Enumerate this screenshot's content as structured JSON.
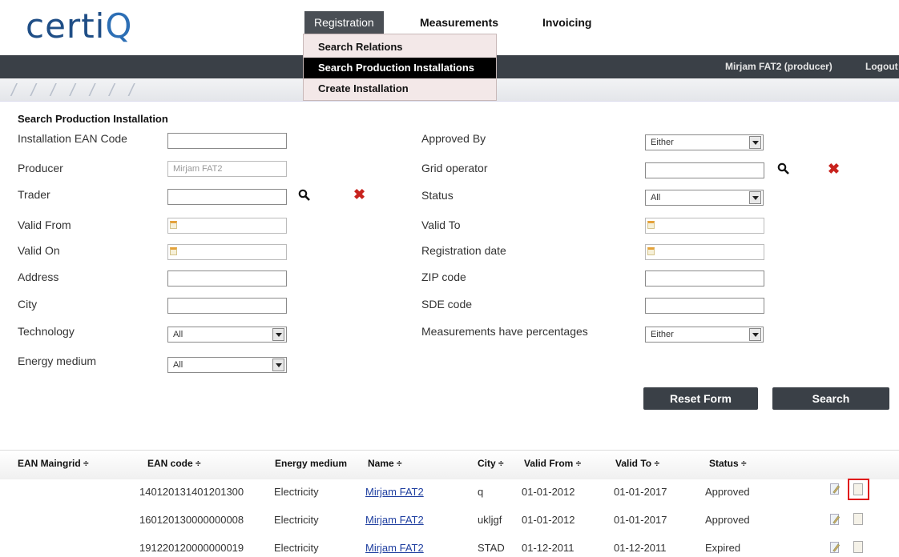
{
  "brand": {
    "logo_prefix": "certi",
    "logo_q": "Q"
  },
  "nav": {
    "items": [
      "Registration",
      "Measurements",
      "Invoicing"
    ],
    "dropdown": [
      "Search Relations",
      "Search Production Installations",
      "Create Installation"
    ]
  },
  "user": {
    "name": "Mirjam FAT2 (producer)",
    "logout": "Logout"
  },
  "form": {
    "title": "Search Production Installation",
    "labels": {
      "ean": "Installation EAN Code",
      "producer": "Producer",
      "trader": "Trader",
      "valid_from": "Valid From",
      "valid_on": "Valid On",
      "address": "Address",
      "city": "City",
      "technology": "Technology",
      "energy_medium": "Energy medium",
      "approved_by": "Approved By",
      "grid_operator": "Grid operator",
      "status": "Status",
      "valid_to": "Valid To",
      "registration_date": "Registration date",
      "zip": "ZIP code",
      "sde": "SDE code",
      "measurements_pct": "Measurements have percentages"
    },
    "values": {
      "producer": "Mirjam FAT2",
      "technology": "All",
      "energy_medium": "All",
      "approved_by": "Either",
      "status": "All",
      "measurements_pct": "Either"
    },
    "buttons": {
      "reset": "Reset Form",
      "search": "Search"
    }
  },
  "table": {
    "headers": [
      "EAN Maingrid ÷",
      "EAN code ÷",
      "Energy medium",
      "Name ÷",
      "City ÷",
      "Valid From ÷",
      "Valid To ÷",
      "Status ÷"
    ],
    "rows": [
      {
        "ean_maingrid": "",
        "ean": "140120131401201300",
        "medium": "Electricity",
        "name": "Mirjam FAT2",
        "city": "q",
        "valid_from": "01-01-2012",
        "valid_to": "01-01-2017",
        "status": "Approved"
      },
      {
        "ean_maingrid": "",
        "ean": "160120130000000008",
        "medium": "Electricity",
        "name": "Mirjam FAT2",
        "city": "ukljgf",
        "valid_from": "01-01-2012",
        "valid_to": "01-01-2017",
        "status": "Approved"
      },
      {
        "ean_maingrid": "",
        "ean": "191220120000000019",
        "medium": "Electricity",
        "name": "Mirjam FAT2",
        "city": "STAD",
        "valid_from": "01-12-2011",
        "valid_to": "01-12-2011",
        "status": "Expired"
      }
    ]
  },
  "icons": {
    "search": "search-icon",
    "clear": "close-icon",
    "calendar": "calendar-icon",
    "edit": "edit-icon",
    "clipboard": "clipboard-icon",
    "dropdown": "chevron-down-icon"
  },
  "colors": {
    "brand": "#1f4e86",
    "bar": "#3a4047",
    "link": "#1f3fa0",
    "clear_icon": "#c8231e",
    "highlight": "#e01b1b"
  }
}
